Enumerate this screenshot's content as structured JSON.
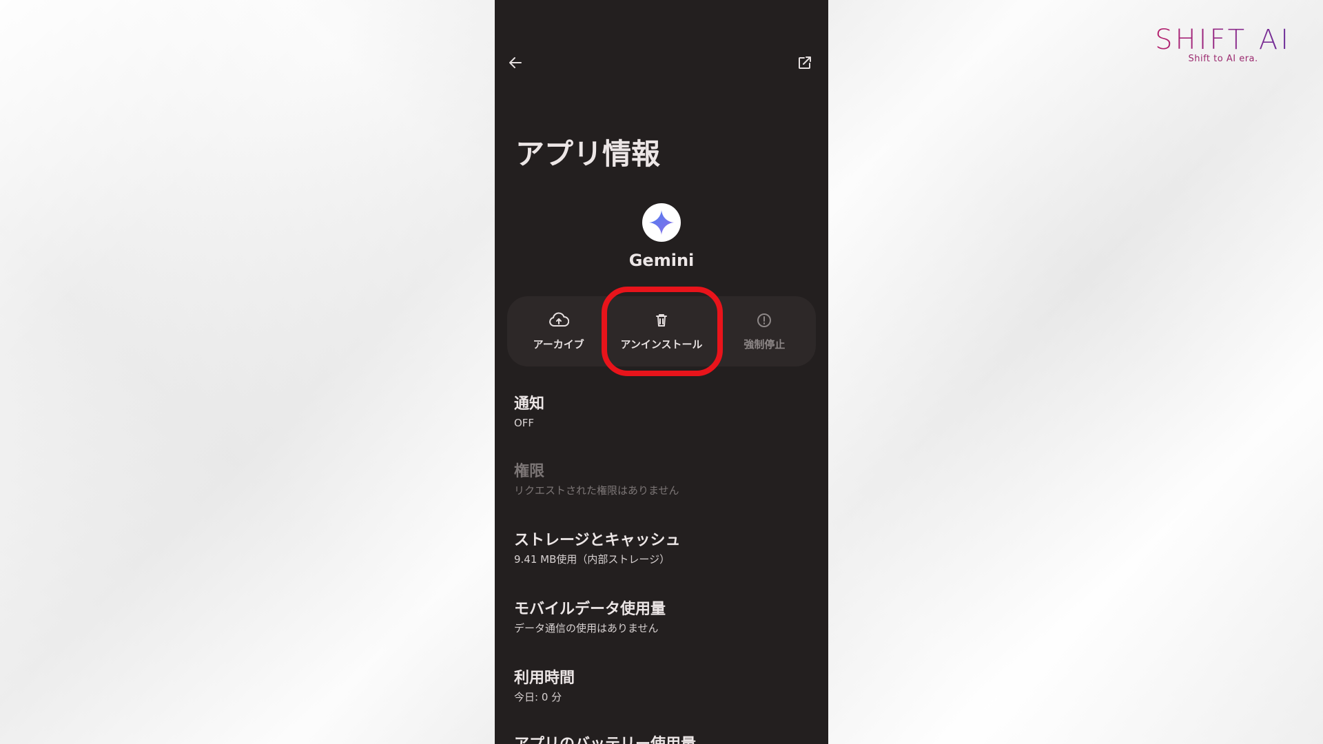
{
  "branding": {
    "logo_text": "SHIFT AI",
    "tagline": "Shift to AI era."
  },
  "screen": {
    "title": "アプリ情報",
    "app": {
      "name": "Gemini",
      "icon": "gemini-sparkle-icon"
    },
    "actions": [
      {
        "label": "アーカイブ",
        "icon": "cloud-upload-icon",
        "enabled": true
      },
      {
        "label": "アンインストール",
        "icon": "trash-icon",
        "enabled": true,
        "highlighted": true
      },
      {
        "label": "強制停止",
        "icon": "alert-circle-icon",
        "enabled": false
      }
    ],
    "settings": [
      {
        "title": "通知",
        "subtitle": "OFF",
        "enabled": true
      },
      {
        "title": "権限",
        "subtitle": "リクエストされた権限はありません",
        "enabled": false
      },
      {
        "title": "ストレージとキャッシュ",
        "subtitle": "9.41 MB使用（内部ストレージ）",
        "enabled": true
      },
      {
        "title": "モバイルデータ使用量",
        "subtitle": "データ通信の使用はありません",
        "enabled": true
      },
      {
        "title": "利用時間",
        "subtitle": "今日: 0 分",
        "enabled": true
      },
      {
        "title": "アプリのバッテリー使用量",
        "subtitle": "",
        "enabled": true
      }
    ]
  },
  "colors": {
    "highlight": "#e8141b",
    "screen_bg": "#231f1f",
    "gemini_blue": "#4a7cf0"
  }
}
